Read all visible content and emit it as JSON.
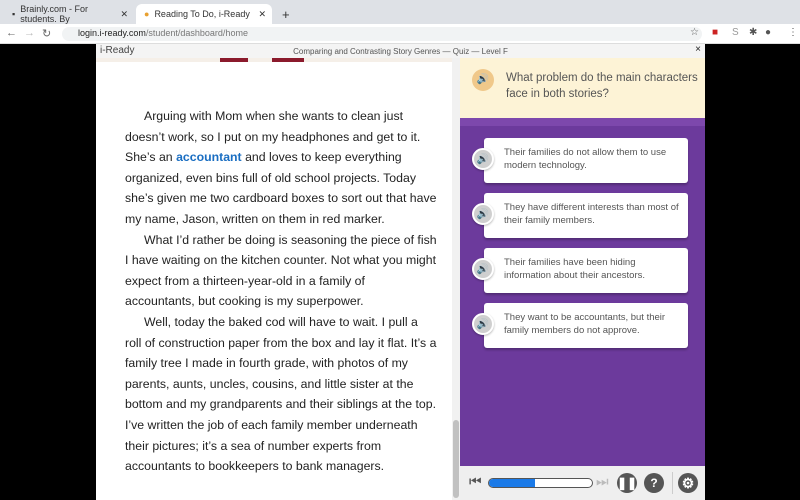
{
  "browser": {
    "tabs": [
      {
        "label": "Brainly.com - For students. By"
      },
      {
        "label": "Reading To Do, i-Ready"
      }
    ],
    "url_host": "login.i-ready.com",
    "url_path": "/student/dashboard/home"
  },
  "header": {
    "logo": "i-Ready",
    "title": "Comparing and Contrasting Story Genres — Quiz — Level F",
    "close": "×"
  },
  "reading": {
    "p1_a": "Arguing with Mom when she wants to clean just doesn’t work, so I put on my headphones and get to it. She’s an ",
    "p1_kw": "accountant",
    "p1_b": " and loves to keep everything organized, even bins full of old school projects. Today she’s given me two cardboard boxes to sort out that have my name, Jason, written on them in red marker.",
    "p2": "What I’d rather be doing is seasoning the piece of fish I have waiting on the kitchen counter. Not what you might expect from a thirteen-year-old in a family of accountants, but cooking is my superpower.",
    "p3": "Well, today the baked cod will have to wait. I pull a roll of construction paper from the box and lay it flat. It’s a family tree I made in fourth grade, with photos of my parents, aunts, uncles, cousins, and little sister at the bottom and my grandparents and their siblings at the top. I’ve written the job of each family member underneath their pictures; it’s a sea of number experts from accountants to bookkeepers to bank managers."
  },
  "question": {
    "text": "What problem do the main characters face in both stories?"
  },
  "options": [
    {
      "text": "Their families do not allow them to use modern technology."
    },
    {
      "text": "They have different interests than most of their family members."
    },
    {
      "text": "Their families have been hiding information about their ancestors."
    },
    {
      "text": "They want to be accountants, but their family members do not approve."
    }
  ],
  "player": {
    "progress_percent": 45
  },
  "colors": {
    "accent": "#6c3a9c",
    "question_bg": "#fdf3d6",
    "keyword": "#1a6ec2",
    "progress": "#1a7ae8"
  }
}
